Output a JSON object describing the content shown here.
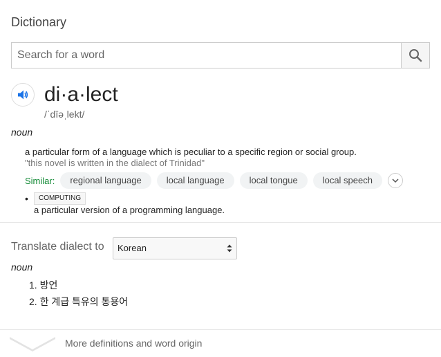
{
  "header": {
    "title": "Dictionary"
  },
  "search": {
    "placeholder": "Search for a word",
    "value": ""
  },
  "entry": {
    "word": "di·a·lect",
    "phonetic": "/ˈdīəˌlekt/",
    "part_of_speech": "noun",
    "definitions": [
      {
        "text": "a particular form of a language which is peculiar to a specific region or social group.",
        "example": "\"this novel is written in the dialect of Trinidad\"",
        "similar_label": "Similar:",
        "similar": [
          "regional language",
          "local language",
          "local tongue",
          "local speech"
        ]
      },
      {
        "tag": "COMPUTING",
        "text": "a particular version of a programming language."
      }
    ]
  },
  "translate": {
    "label": "Translate dialect to",
    "language": "Korean",
    "part_of_speech": "noun",
    "items": [
      "1. 방언",
      "2. 한 계급 특유의 통용어"
    ]
  },
  "footer": {
    "more_label": "More definitions and word origin"
  },
  "icons": {
    "search": "search-icon",
    "speaker": "speaker-icon",
    "expand": "chevron-down-icon",
    "select_arrows": "select-arrows-icon",
    "more": "chevron-down-icon"
  },
  "colors": {
    "accent": "#1a73e8",
    "similar": "#138a36",
    "chip_bg": "#f1f3f4"
  }
}
